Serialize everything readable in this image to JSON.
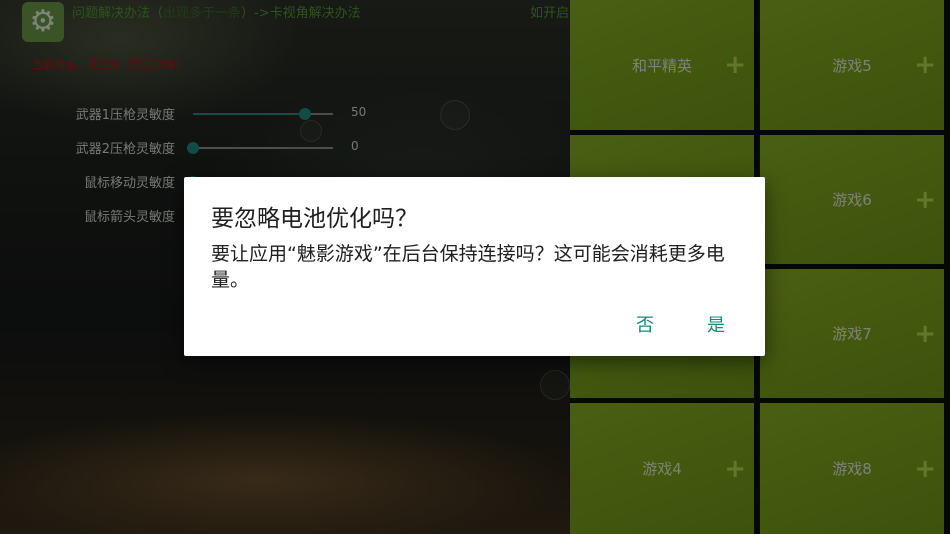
{
  "header": {
    "app_icon": "gear-icon",
    "link_text_1": "问题解决办法（",
    "link_text_muted": "出现多于一条",
    "link_text_2": "）->卡视角解决办法",
    "right_text": "如开启"
  },
  "warning": "当前版本：未连接（点击连接）",
  "sliders": [
    {
      "label": "武器1压枪灵敏度",
      "value": "50",
      "level": 0.8
    },
    {
      "label": "武器2压枪灵敏度",
      "value": "0",
      "level": 0.0
    },
    {
      "label": "鼠标移动灵敏度",
      "value": "",
      "level": 0.0
    },
    {
      "label": "鼠标箭头灵敏度",
      "value": "",
      "level": 0.0
    }
  ],
  "tiles": [
    {
      "label": "和平精英",
      "plus": "+"
    },
    {
      "label": "游戏5",
      "plus": "+"
    },
    {
      "label": "",
      "plus": ""
    },
    {
      "label": "游戏6",
      "plus": "+"
    },
    {
      "label": "",
      "plus": ""
    },
    {
      "label": "游戏7",
      "plus": "+"
    },
    {
      "label": "游戏4",
      "plus": "+"
    },
    {
      "label": "游戏8",
      "plus": "+"
    }
  ],
  "dialog": {
    "title": "要忽略电池优化吗？",
    "message": "要让应用“魅影游戏”在后台保持连接吗？这可能会消耗更多电量。",
    "deny_label": "否",
    "allow_label": "是"
  },
  "colors": {
    "tile_green": "#7aa31a",
    "accent_teal": "#138a82",
    "warning_red": "#b01818"
  }
}
